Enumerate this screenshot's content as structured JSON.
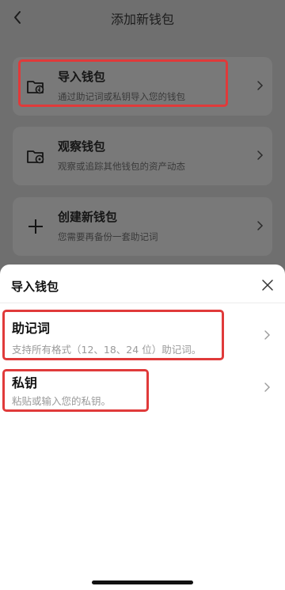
{
  "header": {
    "title": "添加新钱包"
  },
  "cards": [
    {
      "title": "导入钱包",
      "subtitle": "通过助记词或私钥导入您的钱包"
    },
    {
      "title": "观察钱包",
      "subtitle": "观察或追踪其他钱包的资产动态"
    },
    {
      "title": "创建新钱包",
      "subtitle": "您需要再备份一套助记词"
    }
  ],
  "sheet": {
    "title": "导入钱包",
    "options": [
      {
        "title": "助记词",
        "subtitle": "支持所有格式（12、18、24 位）助记词。"
      },
      {
        "title": "私钥",
        "subtitle": "粘贴或输入您的私钥。"
      }
    ]
  },
  "colors": {
    "highlight": "#e03a3a",
    "overlay": "#6f6f6f",
    "sheet": "#ffffff"
  },
  "icons": [
    "back-arrow-icon",
    "wallet-import-icon",
    "wallet-watch-icon",
    "plus-icon",
    "chevron-right-icon",
    "close-icon"
  ]
}
